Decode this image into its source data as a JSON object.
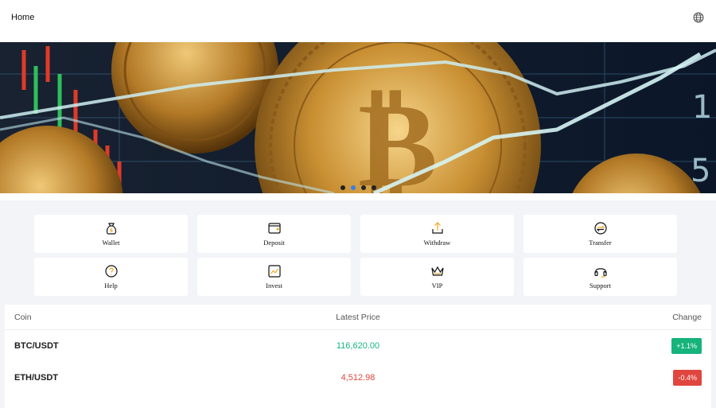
{
  "header": {
    "title": "Home",
    "language_icon": "globe-icon"
  },
  "banner": {
    "slides": 4,
    "active_slide": 2
  },
  "actions": [
    {
      "label": "Wallet",
      "icon": "money-bag-icon"
    },
    {
      "label": "Deposit",
      "icon": "wallet-icon"
    },
    {
      "label": "Withdraw",
      "icon": "upload-icon"
    },
    {
      "label": "Transfer",
      "icon": "transfer-icon"
    },
    {
      "label": "Help",
      "icon": "question-icon"
    },
    {
      "label": "Invest",
      "icon": "chart-icon"
    },
    {
      "label": "VIP",
      "icon": "crown-icon"
    },
    {
      "label": "Support",
      "icon": "headset-icon"
    }
  ],
  "market": {
    "headers": {
      "coin": "Coin",
      "price": "Latest Price",
      "change": "Change"
    },
    "rows": [
      {
        "pair": "BTC/USDT",
        "price": "116,620.00",
        "change": "+1.1%",
        "direction": "up"
      },
      {
        "pair": "ETH/USDT",
        "price": "4,512.98",
        "change": "-0.4%",
        "direction": "down"
      }
    ]
  },
  "colors": {
    "up": "#16b37b",
    "down": "#e0463f",
    "accent": "#f2a61f",
    "active_dot": "#3b7fe0"
  }
}
